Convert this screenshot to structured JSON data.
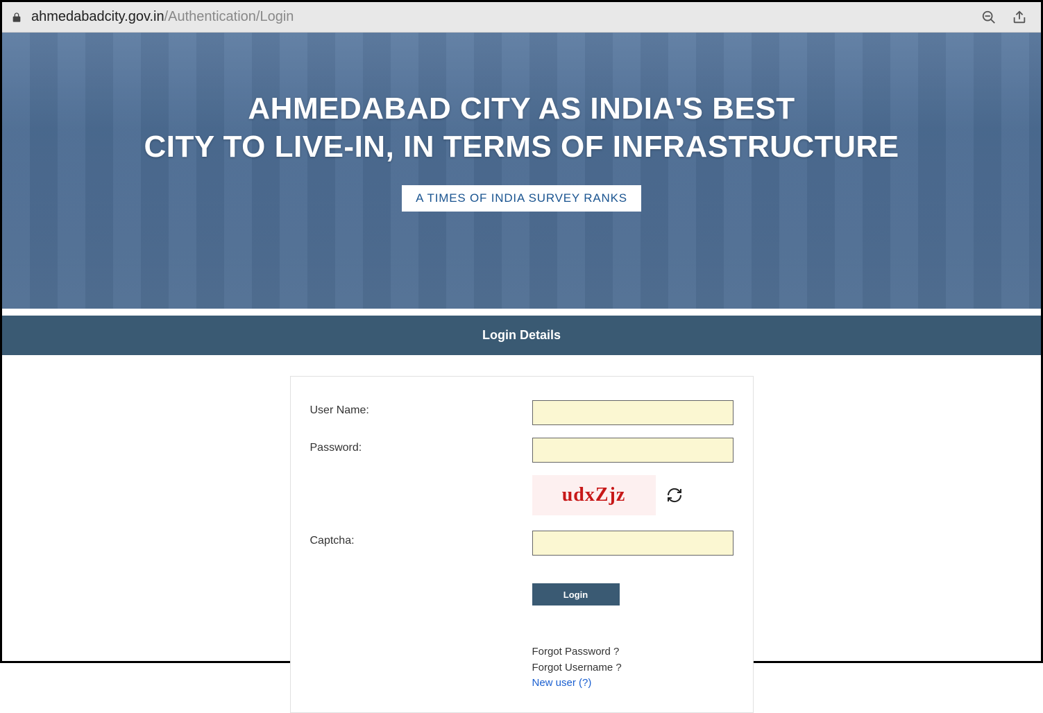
{
  "browser": {
    "url_domain": "ahmedabadcity.gov.in",
    "url_path": "/Authentication/Login"
  },
  "hero": {
    "title_line1": "AHMEDABAD CITY AS INDIA'S BEST",
    "title_line2": "CITY TO LIVE-IN, IN TERMS OF INFRASTRUCTURE",
    "badge": "A TIMES OF INDIA SURVEY RANKS"
  },
  "login": {
    "header": "Login Details",
    "username_label": "User Name:",
    "password_label": "Password:",
    "captcha_label": "Captcha:",
    "captcha_text": "udxZjz",
    "button": "Login",
    "forgot_password": "Forgot Password ?",
    "forgot_username": "Forgot Username ?",
    "new_user": "New user (?)"
  }
}
